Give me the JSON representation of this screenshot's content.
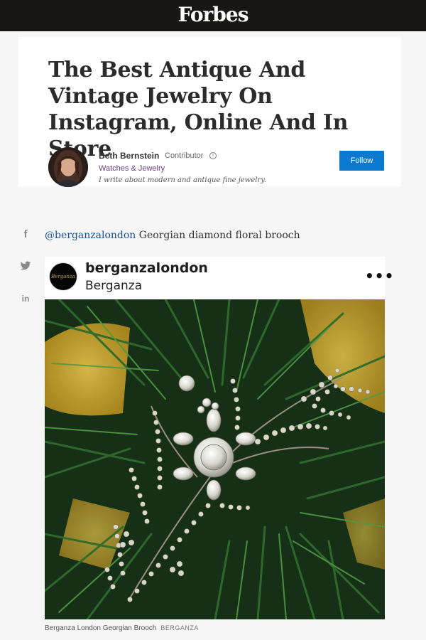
{
  "header": {
    "logo": "Forbes"
  },
  "article": {
    "title": "The Best Antique And Vintage Jewelry On Instagram, Online And In Store"
  },
  "author": {
    "name": "Beth Bernstein",
    "role": "Contributor",
    "section": "Watches & Jewelry",
    "bio": "I write about modern and antique fine jewelry.",
    "follow_label": "Follow"
  },
  "share": {
    "facebook": "f",
    "twitter": "twitter-icon",
    "linkedin": "in"
  },
  "body": {
    "handle": "@berganzalondon",
    "caption_text": " Georgian diamond floral brooch"
  },
  "instagram": {
    "avatar_text": "Berganza",
    "username": "berganzalondon",
    "display_name": "Berganza",
    "more": "•••"
  },
  "image": {
    "caption": "Berganza London Georgian Brooch",
    "credit": "BERGANZA"
  },
  "colors": {
    "topbar": "#181716",
    "follow": "#0b79d0",
    "section_link": "#6b3f7d",
    "handle_link": "#1a4f8b"
  }
}
